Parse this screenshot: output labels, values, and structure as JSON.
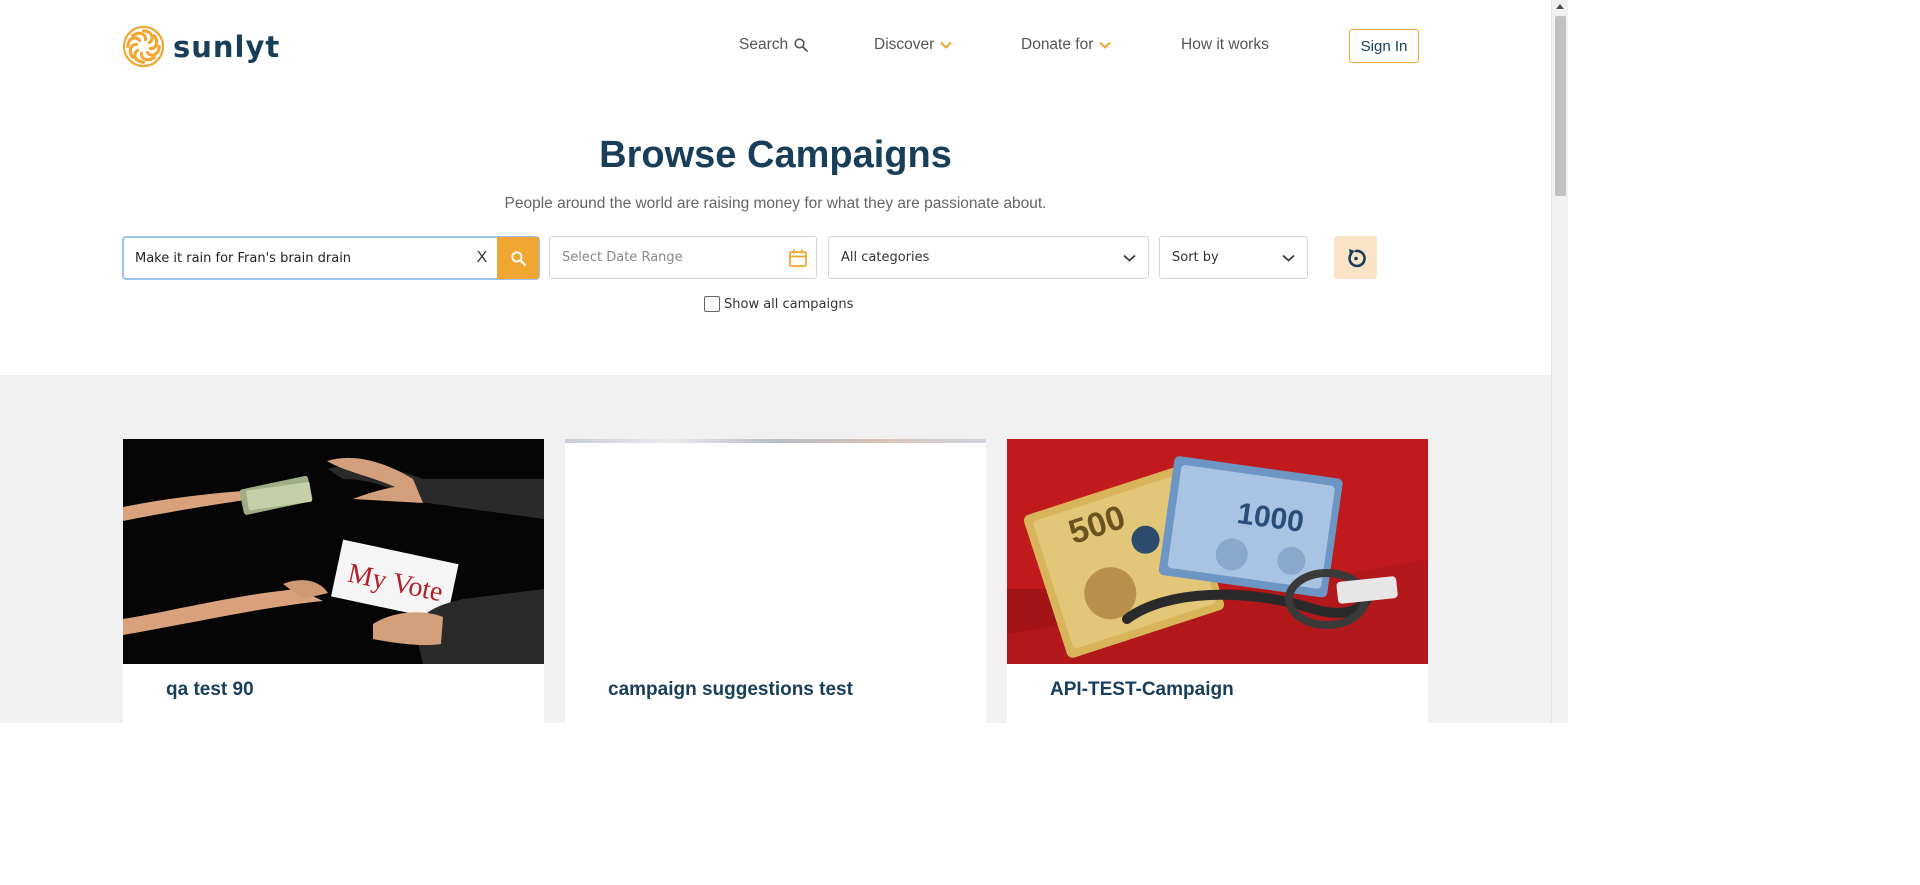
{
  "brand": {
    "name": "sunlyt",
    "accent": "#f0a630",
    "navy": "#183e59"
  },
  "nav": {
    "search_label": "Search",
    "discover_label": "Discover",
    "donate_label": "Donate for",
    "how_label": "How it works",
    "signin_label": "Sign In"
  },
  "hero": {
    "title": "Browse Campaigns",
    "subtitle": "People around the world are raising money for what they are passionate about."
  },
  "filters": {
    "search_value": "Make it rain for Fran's brain drain",
    "clear_label": "X",
    "date_placeholder": "Select Date Range",
    "category_selected": "All categories",
    "sort_selected": "Sort by",
    "show_all_label": "Show all campaigns",
    "show_all_checked": false
  },
  "campaigns": [
    {
      "title": "qa test 90",
      "image": "money-for-vote-photo"
    },
    {
      "title": "campaign suggestions test",
      "image": "blank-image"
    },
    {
      "title": "API-TEST-Campaign",
      "image": "peso-bills-handcuffs-photo"
    }
  ]
}
